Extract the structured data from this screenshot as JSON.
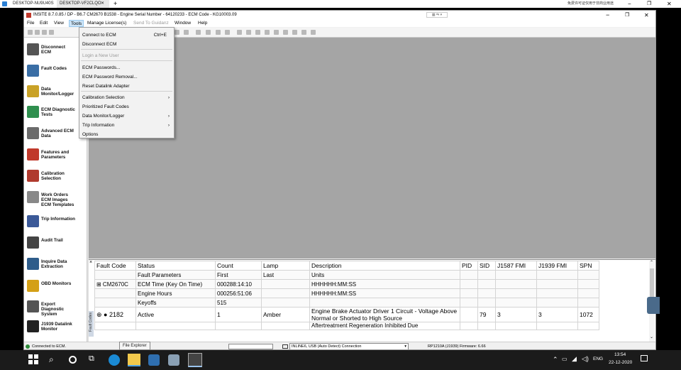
{
  "remote": {
    "tabs": [
      "DESKTOP-NU9U40S",
      "DESKTOP-VF2CLQO"
    ],
    "add_tab": "+",
    "right_text": "免费许可证仅用于非商业用途"
  },
  "window": {
    "title": "INSITE 8.7.0.85 / DP - B6.7 CM2670 B1538 - Engine Serial Number - 64120233 - ECM Code - KG10003.09",
    "minimize": "−",
    "restore": "❐",
    "close": "✕"
  },
  "menu": [
    "File",
    "Edit",
    "View",
    "Tools",
    "Manage License(s)",
    "Send To Guidanz",
    "Window",
    "Help"
  ],
  "tools_menu": {
    "items": [
      {
        "label": "Connect to ECM",
        "shortcut": "Ctrl+E",
        "disabled": false,
        "arrow": false
      },
      {
        "label": "Disconnect ECM",
        "shortcut": "",
        "disabled": false,
        "arrow": false
      },
      {
        "label": "Login a New User",
        "shortcut": "",
        "disabled": true,
        "arrow": false
      },
      {
        "label": "ECM Passwords...",
        "shortcut": "",
        "disabled": false,
        "arrow": false
      },
      {
        "label": "ECM Password Removal...",
        "shortcut": "",
        "disabled": false,
        "arrow": false
      },
      {
        "label": "Reset Datalink Adapter",
        "shortcut": "",
        "disabled": false,
        "arrow": false
      },
      {
        "label": "Calibration Selection",
        "shortcut": "",
        "disabled": false,
        "arrow": true
      },
      {
        "label": "Prioritized Fault Codes",
        "shortcut": "",
        "disabled": false,
        "arrow": false
      },
      {
        "label": "Data Monitor/Logger",
        "shortcut": "",
        "disabled": false,
        "arrow": true
      },
      {
        "label": "Trip Information",
        "shortcut": "",
        "disabled": false,
        "arrow": true
      },
      {
        "label": "Options",
        "shortcut": "",
        "disabled": false,
        "arrow": false
      }
    ],
    "arrow_glyph": "›"
  },
  "sidebar": [
    {
      "label": "Disconnect\nECM",
      "icon": "disconnect-icon",
      "color": "#555555"
    },
    {
      "label": "Fault Codes",
      "icon": "fault-codes-icon",
      "color": "#3a6ea5"
    },
    {
      "label": "Data\nMonitor/Logger",
      "icon": "data-monitor-icon",
      "color": "#c9a227"
    },
    {
      "label": "ECM Diagnostic\nTests",
      "icon": "ecm-diagnostic-icon",
      "color": "#2f8f4e"
    },
    {
      "label": "Advanced ECM\nData",
      "icon": "advanced-data-icon",
      "color": "#6b6b6b"
    },
    {
      "label": "Features and\nParameters",
      "icon": "features-icon",
      "color": "#c0392b"
    },
    {
      "label": "Calibration\nSelection",
      "icon": "calibration-icon",
      "color": "#b03a2e"
    },
    {
      "label": "Work Orders\nECM Images\nECM Templates",
      "icon": "work-orders-icon",
      "color": "#888888"
    },
    {
      "label": "Trip Information",
      "icon": "trip-info-icon",
      "color": "#3b5998"
    },
    {
      "label": "Audit Trail",
      "icon": "audit-trail-icon",
      "color": "#444444"
    },
    {
      "label": "Inquire Data\nExtraction",
      "icon": "inquire-icon",
      "color": "#2e5c8a"
    },
    {
      "label": "OBD Monitors",
      "icon": "obd-icon",
      "color": "#d4a017"
    },
    {
      "label": "Export\nDiagnostic\nSystem",
      "icon": "export-icon",
      "color": "#555555"
    },
    {
      "label": "J1939 Datalink\nMonitor",
      "icon": "datalink-icon",
      "color": "#222222"
    }
  ],
  "fault_table": {
    "panel_label": "Fault Codes",
    "close": "×",
    "headers": [
      "Fault Code",
      "Status",
      "Count",
      "Lamp",
      "Description",
      "PID",
      "SID",
      "J1587 FMI",
      "J1939 FMI",
      "SPN"
    ],
    "rows": [
      {
        "kind": "sub",
        "cells": [
          "",
          "Fault Parameters",
          "First",
          "Last",
          "Units",
          "",
          "",
          "",
          "",
          ""
        ]
      },
      {
        "kind": "sub",
        "cells": [
          "⊞ CM2670C",
          "ECM Time (Key On Time)",
          "000288:14:10",
          "",
          "HHHHHH:MM:SS",
          "",
          "",
          "",
          "",
          ""
        ]
      },
      {
        "kind": "sub",
        "cells": [
          "",
          "Engine Hours",
          "000256:51:06",
          "",
          "HHHHHH:MM:SS",
          "",
          "",
          "",
          "",
          ""
        ]
      },
      {
        "kind": "sub",
        "cells": [
          "",
          "Keyoffs",
          "515",
          "",
          "",
          "",
          "",
          "",
          "",
          ""
        ]
      },
      {
        "kind": "main",
        "cells": [
          "⊕ ● 2182",
          "Active",
          "1",
          "Amber",
          "Engine Brake Actuator Driver 1 Circuit - Voltage Above Normal or Shorted to High Source",
          "",
          "79",
          "3",
          "3",
          "1072"
        ]
      },
      {
        "kind": "cut",
        "cells": [
          "",
          "",
          "",
          "",
          "Aftertreatment Regeneration Inhibited Due",
          "",
          "",
          "",
          "",
          ""
        ]
      }
    ]
  },
  "status": {
    "connected": "Connected to ECM.",
    "adapter": "INLINE6, USB (Auto Detect) Connection",
    "protocol": "RP1210A (J1939)  Firmware: 6.66"
  },
  "tooltip": "File Explorer",
  "taskbar": {
    "lang": "ENG",
    "time": "13:54",
    "date": "22-12-2020"
  }
}
